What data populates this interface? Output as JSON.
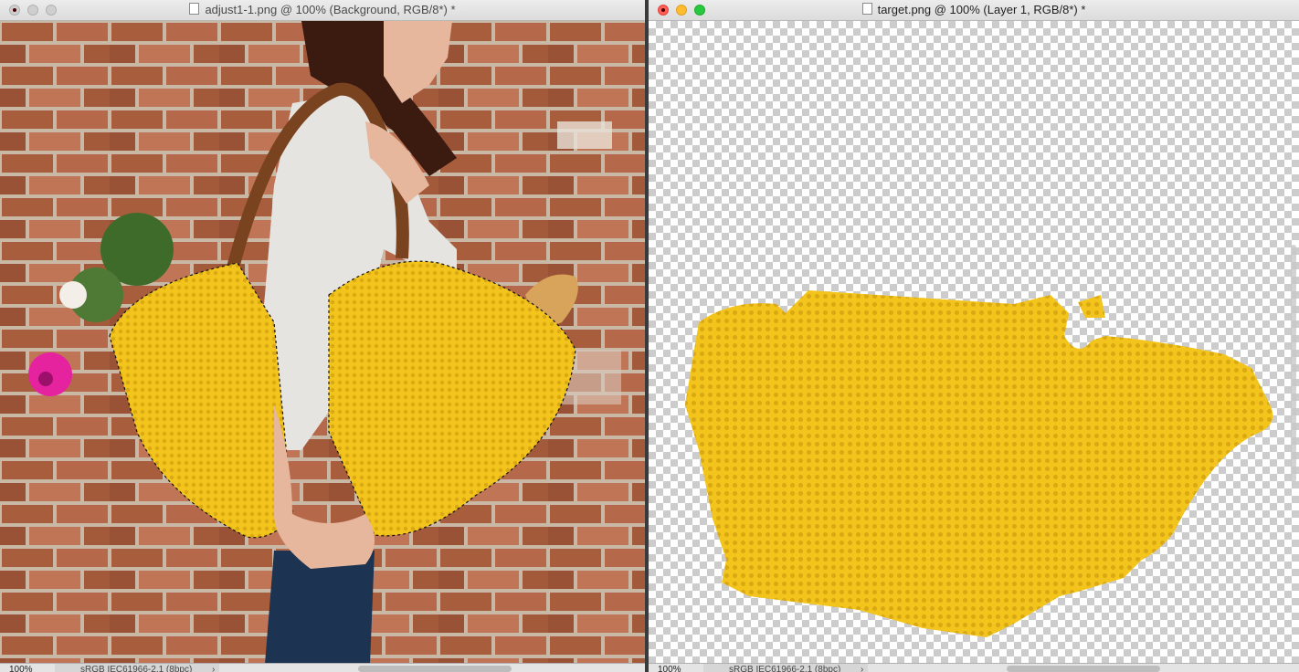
{
  "left_window": {
    "title": "adjust1-1.png @ 100% (Background, RGB/8*) *",
    "zoom": "100%",
    "color_profile": "sRGB IEC61966-2.1 (8bpc)"
  },
  "right_window": {
    "title": "target.png @ 100% (Layer 1, RGB/8*) *",
    "zoom": "100%",
    "color_profile": "sRGB IEC61966-2.1 (8bpc)"
  },
  "colors": {
    "brick": "#a85d3d",
    "mortar": "#c9b8a6",
    "knit_yellow": "#f2c41c",
    "knit_shadow": "#d9a812",
    "strap_brown": "#7a4320",
    "sweater": "#e6e4e0",
    "jeans": "#1d3352",
    "flower_pink": "#e5239e"
  },
  "icons": {
    "document": "document-icon",
    "scroll": "chevron-right-icon"
  }
}
